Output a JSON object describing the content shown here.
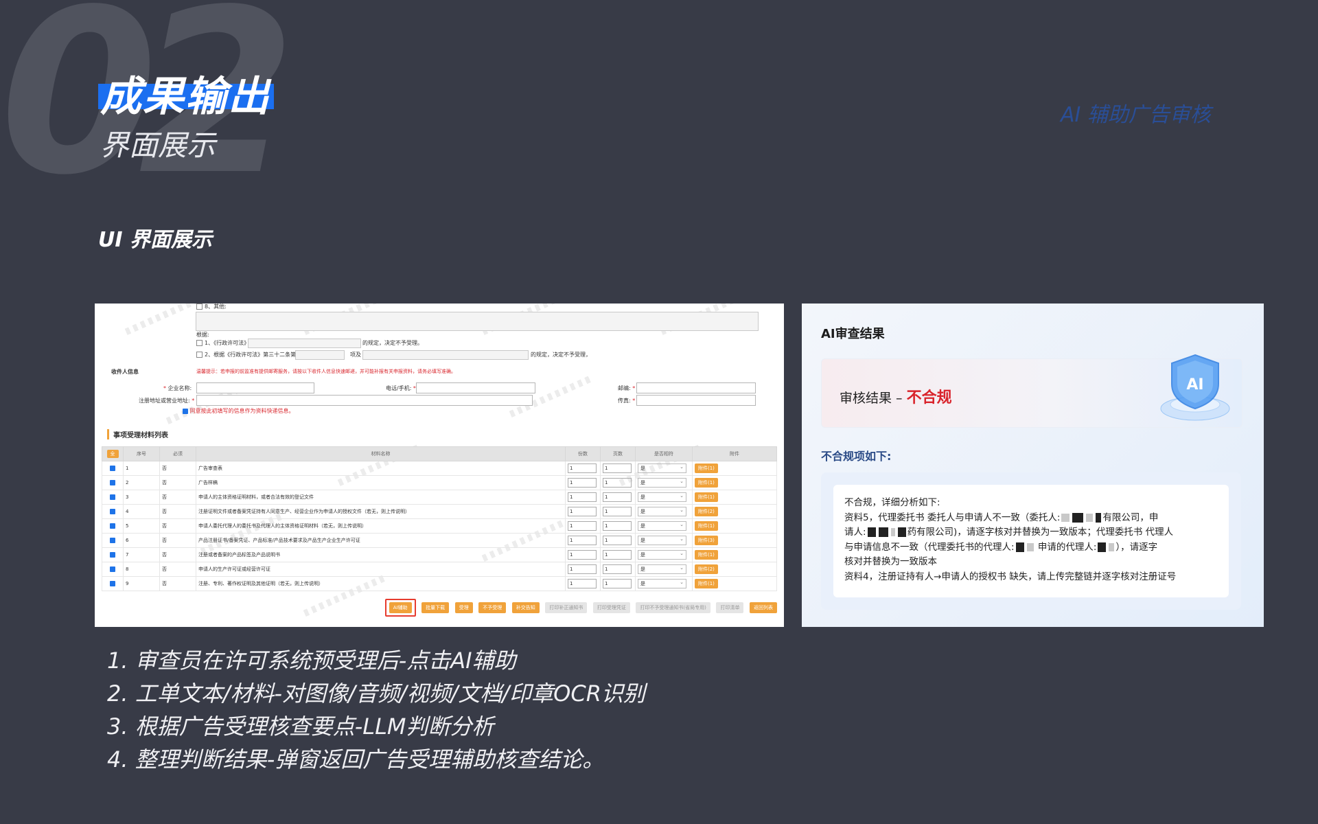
{
  "background_number": "02",
  "title": "成果输出",
  "subtitle": "界面展示",
  "corner_tag": "AI 辅助广告审核",
  "section_title": "UI 界面展示",
  "colors": {
    "accent": "#1b6ff0",
    "background": "#383b47",
    "button": "#f0a23a",
    "alert": "#d9242c"
  },
  "form": {
    "other_option": "8、其他:",
    "basis_label": "根据:",
    "basis_1_pre": "1、《行政许可法》",
    "basis_1_post": "的规定，决定不予受理。",
    "basis_2_pre": "2、根据《行政许可法》第三十二条第",
    "basis_2_mid": "项及",
    "basis_2_post": "的规定，决定不予受理，",
    "recipient_label": "收件人信息",
    "notice": "温馨提示：若申报的前监准有提供邮寄服务，请按以下收件人信息快速邮递，并可能补报有关申报资料，请务必填写准确。",
    "company_label": "企业名称:",
    "phone_label": "电话/手机:",
    "email_label": "邮编:",
    "address_label": "注册地址或营业地址:",
    "fax_label": "传真:",
    "agree_label": "同意按此初填写的信息作为资料快递信息。",
    "list_title": "事项受理材料列表",
    "columns": [
      "全",
      "序号",
      "必须",
      "材料名称",
      "份数",
      "页数",
      "是否相符",
      "附件"
    ],
    "rows": [
      {
        "no": "1",
        "req": "否",
        "name": "广告审查表",
        "copies": "1",
        "pages": "1",
        "match": "是",
        "attach": "附件(1)"
      },
      {
        "no": "2",
        "req": "否",
        "name": "广告样稿",
        "copies": "1",
        "pages": "1",
        "match": "是",
        "attach": "附件(1)"
      },
      {
        "no": "3",
        "req": "否",
        "name": "申请人的主体资格证明材料，或者合法有效的登记文件",
        "copies": "1",
        "pages": "1",
        "match": "是",
        "attach": "附件(1)"
      },
      {
        "no": "4",
        "req": "否",
        "name": "注册证明文件或者备案凭证持有人同意生产、经营企业作为申请人的授权文件（若无，则上传说明）",
        "copies": "1",
        "pages": "1",
        "match": "是",
        "attach": "附件(2)"
      },
      {
        "no": "5",
        "req": "否",
        "name": "申请人委托代理人的委托书及代理人的主体资格证明材料（若无，则上传说明）",
        "copies": "1",
        "pages": "1",
        "match": "是",
        "attach": "附件(1)"
      },
      {
        "no": "6",
        "req": "否",
        "name": "产品注册证书/备案凭证、产品标准/产品技术要求及产品生产企业生产许可证",
        "copies": "1",
        "pages": "1",
        "match": "是",
        "attach": "附件(3)"
      },
      {
        "no": "7",
        "req": "否",
        "name": "注册或者备案的产品标签及产品说明书",
        "copies": "1",
        "pages": "1",
        "match": "是",
        "attach": "附件(1)"
      },
      {
        "no": "8",
        "req": "否",
        "name": "申请人的生产许可证或经营许可证",
        "copies": "1",
        "pages": "1",
        "match": "是",
        "attach": "附件(2)"
      },
      {
        "no": "9",
        "req": "否",
        "name": "注册、专利、著作权证明及其他证明（若无，则上传说明）",
        "copies": "1",
        "pages": "1",
        "match": "是",
        "attach": "附件(1)"
      }
    ],
    "buttons": {
      "ai": "AI辅助",
      "batch_download": "批量下载",
      "accept": "受理",
      "reject": "不予受理",
      "supplement": "补交告知",
      "print_notice": "打印补正通知书",
      "print_receipt": "打印受理凭证",
      "print_reject": "打印不予受理通知书(省局专用)",
      "print_list": "打印清单",
      "back": "返回列表"
    }
  },
  "result": {
    "title": "AI审查结果",
    "status_label": "审核结果 –",
    "status_value": "不合规",
    "issues_title": "不合规项如下:",
    "line1": "不合规，详细分析如下:",
    "line2_a": "资料5，代理委托书 委托人与申请人不一致（委托人:",
    "line2_b": "有限公司，申",
    "line3_a": "请人:",
    "line3_b": "药有限公司)，请逐字核对并替换为一致版本；代理委托书 代理人",
    "line4_a": "与申请信息不一致（代理委托书的代理人:",
    "line4_b": "申请的代理人:",
    "line4_c": "），请逐字",
    "line5": "核对并替换为一致版本",
    "line6": "资料4，注册证持有人→申请人的授权书 缺失，请上传完整链并逐字核对注册证号"
  },
  "steps": [
    "1. 审查员在许可系统预受理后-点击AI辅助",
    "2. 工单文本/材料-对图像/音频/视频/文档/印章OCR识别",
    "3. 根据广告受理核查要点-LLM判断分析",
    "4. 整理判断结果-弹窗返回广告受理辅助核查结论。"
  ]
}
